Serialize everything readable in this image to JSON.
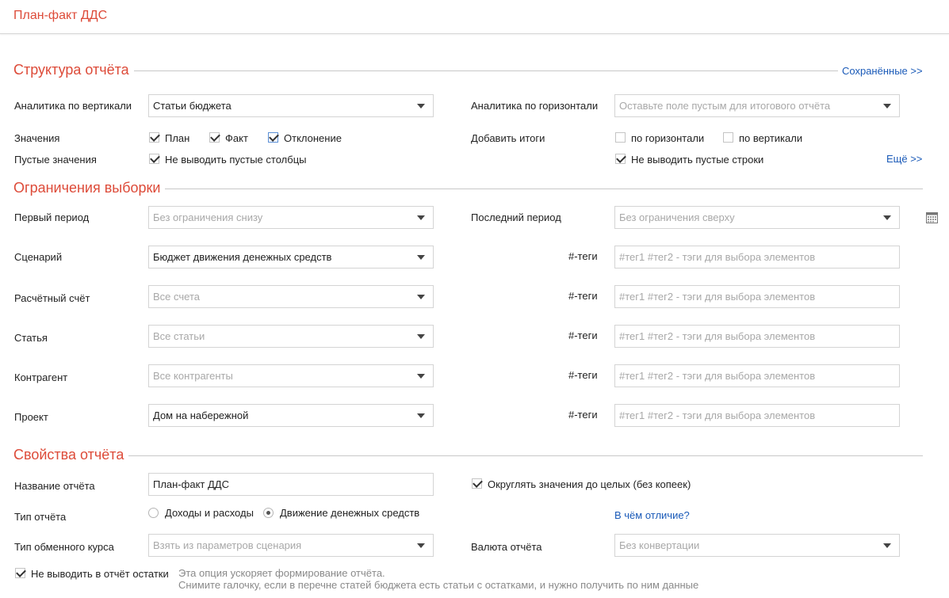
{
  "app": {
    "title": "План-факт ДДС"
  },
  "structure": {
    "title": "Структура отчёта",
    "saved_link": "Сохранённые >>",
    "vertical_label": "Аналитика по вертикали",
    "vertical_value": "Статьи бюджета",
    "horizontal_label": "Аналитика по горизонтали",
    "horizontal_placeholder": "Оставьте поле пустым для итогового отчёта",
    "values_label": "Значения",
    "values": [
      {
        "label": "План",
        "checked": true
      },
      {
        "label": "Факт",
        "checked": true
      },
      {
        "label": "Отклонение",
        "checked": true
      }
    ],
    "totals_label": "Добавить итоги",
    "totals": [
      {
        "label": "по горизонтали",
        "checked": false
      },
      {
        "label": "по вертикали",
        "checked": false
      }
    ],
    "empty_label": "Пустые значения",
    "empty_cols": {
      "label": "Не выводить пустые столбцы",
      "checked": true
    },
    "empty_rows": {
      "label": "Не выводить пустые строки",
      "checked": true
    },
    "more_link": "Ещё >>"
  },
  "filters": {
    "title": "Ограничения выборки",
    "first_period": {
      "label": "Первый период",
      "placeholder": "Без ограничения снизу"
    },
    "last_period": {
      "label": "Последний период",
      "placeholder": "Без ограничения сверху"
    },
    "calendar_icon": "calendar-icon",
    "tags_label": "#-теги",
    "tags_placeholder": "#тег1 #тег2 - тэги для выбора элементов",
    "rows": [
      {
        "label": "Сценарий",
        "value": "Бюджет движения денежных средств",
        "placeholder": ""
      },
      {
        "label": "Расчётный счёт",
        "value": "",
        "placeholder": "Все счета"
      },
      {
        "label": "Статья",
        "value": "",
        "placeholder": "Все статьи"
      },
      {
        "label": "Контрагент",
        "value": "",
        "placeholder": "Все контрагенты"
      },
      {
        "label": "Проект",
        "value": "Дом на набережной",
        "placeholder": ""
      }
    ]
  },
  "properties": {
    "title": "Свойства отчёта",
    "name_label": "Название отчёта",
    "name_value": "План-факт ДДС",
    "round": {
      "label": "Округлять значения до целых (без копеек)",
      "checked": true
    },
    "type_label": "Тип отчёта",
    "types": [
      {
        "label": "Доходы и расходы",
        "selected": false
      },
      {
        "label": "Движение денежных средств",
        "selected": true
      }
    ],
    "diff_link": "В чём отличие?",
    "rate_label": "Тип обменного курса",
    "rate_placeholder": "Взять из параметров сценария",
    "currency_label": "Валюта отчёта",
    "currency_placeholder": "Без конвертации",
    "no_balances": {
      "label": "Не выводить в отчёт остатки",
      "checked": true
    },
    "hint_line1": "Эта опция ускоряет формирование отчёта.",
    "hint_line2": "Снимите галочку, если в перечне статей бюджета есть статьи с остатками, и нужно получить по ним данные"
  }
}
